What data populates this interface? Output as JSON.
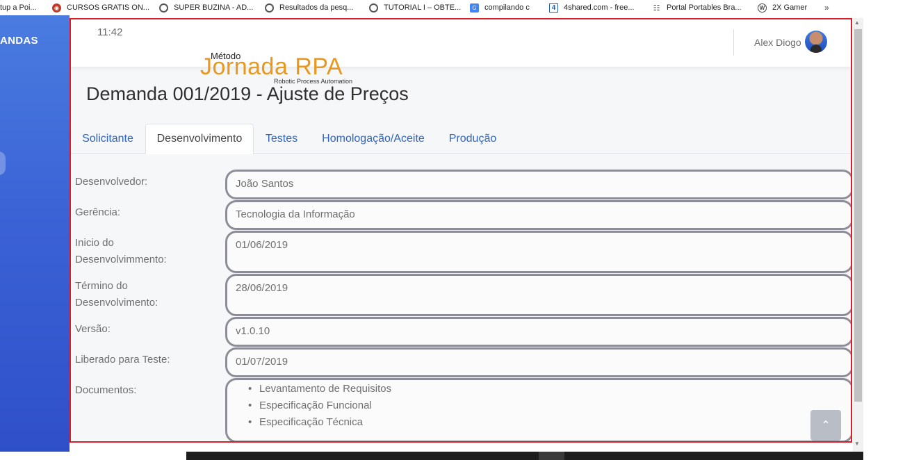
{
  "bookmarks": [
    {
      "label": "tup a Poi...",
      "icon": "",
      "color": ""
    },
    {
      "label": "CURSOS GRATIS ON...",
      "icon": "cursos-icon",
      "color": "#c0392b"
    },
    {
      "label": "SUPER BUZINA - AD...",
      "icon": "globe-icon",
      "color": "#555555"
    },
    {
      "label": "Resultados da pesq...",
      "icon": "globe-icon",
      "color": "#555555"
    },
    {
      "label": "TUTORIAL I – OBTE...",
      "icon": "globe-icon",
      "color": "#555555"
    },
    {
      "label": "compilando c",
      "icon": "translate-icon",
      "color": "#4285f4"
    },
    {
      "label": "4shared.com - free...",
      "icon": "4shared-icon",
      "color": "#1a5fb4"
    },
    {
      "label": "Portal Portables Bra...",
      "icon": "portal-icon",
      "color": "#444444"
    },
    {
      "label": "2X Gamer",
      "icon": "wordpress-icon",
      "color": "#444444"
    }
  ],
  "bookmarks_more": "»",
  "sidebar": {
    "title": "ANDAS"
  },
  "header": {
    "clock": "11:42",
    "user_name": "Alex Diogo"
  },
  "logo": {
    "small": "Método",
    "big": "Jornada RPA",
    "sub": "Robotic Process Automation"
  },
  "page_title": "Demanda 001/2019 - Ajuste de Preços",
  "tabs": [
    {
      "label": "Solicitante",
      "active": false
    },
    {
      "label": "Desenvolvimento",
      "active": true
    },
    {
      "label": "Testes",
      "active": false
    },
    {
      "label": "Homologação/Aceite",
      "active": false
    },
    {
      "label": "Produção",
      "active": false
    }
  ],
  "form": [
    {
      "label": "Desenvolvedor:",
      "value": "João Santos"
    },
    {
      "label": "Gerência:",
      "value": "Tecnologia da Informação"
    },
    {
      "label": "Inicio do\nDesenvolvimmento:",
      "value": "01/06/2019"
    },
    {
      "label": "Término do\nDesenvolvimento:",
      "value": "28/06/2019"
    },
    {
      "label": "Versão:",
      "value": "v1.0.10"
    },
    {
      "label": "Liberado para Teste:",
      "value": "01/07/2019"
    }
  ],
  "documents": {
    "label": "Documentos:",
    "items": [
      "Levantamento de Requisitos",
      "Especificação Funcional",
      "Especificação Técnica"
    ]
  },
  "accent_colors": {
    "tab_link": "#2f64c2",
    "logo": "#e8981d",
    "frame_border": "#d9202a",
    "sidebar": "#3b63d6"
  }
}
